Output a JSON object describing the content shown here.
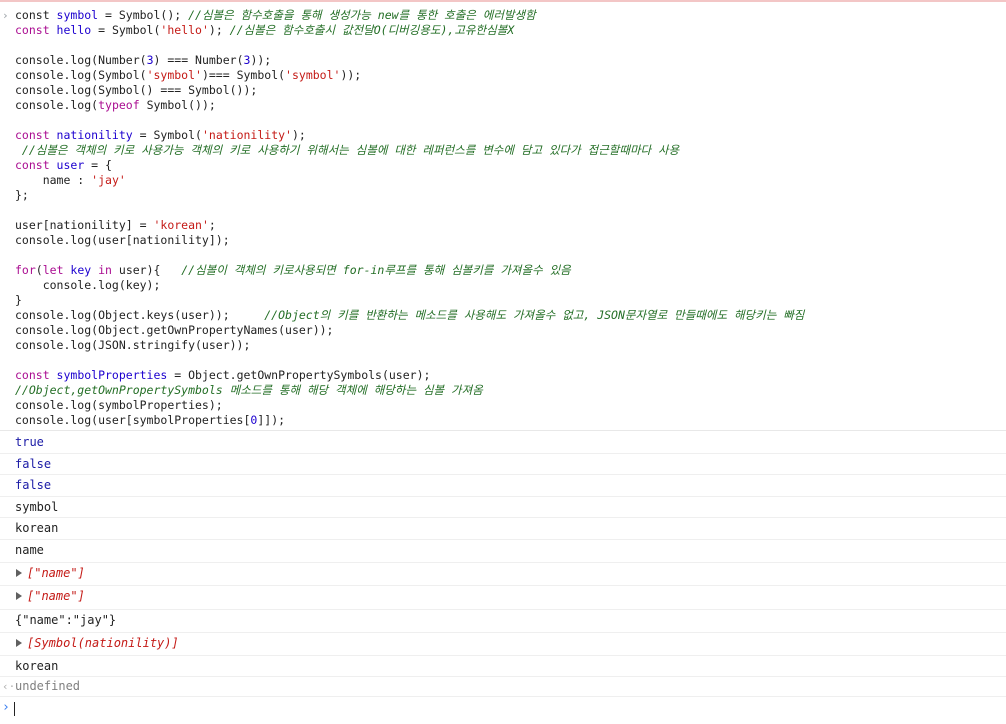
{
  "console": {
    "code_lines": [
      [
        {
          "t": "pl",
          "v": "const "
        },
        {
          "t": "vn",
          "v": "symbol"
        },
        {
          "t": "pl",
          "v": " = Symbol(); "
        },
        {
          "t": "cm",
          "v": "//심볼은 함수호출을 통해 생성가능 new를 통한 호출은 에러발생함"
        }
      ],
      [
        {
          "t": "kw",
          "v": "const "
        },
        {
          "t": "vn",
          "v": "hello"
        },
        {
          "t": "pl",
          "v": " = Symbol("
        },
        {
          "t": "str",
          "v": "'hello'"
        },
        {
          "t": "pl",
          "v": "); "
        },
        {
          "t": "cm",
          "v": "//심볼은 함수호출시 값전달O(디버깅용도),고유한심볼X"
        }
      ],
      [],
      [
        {
          "t": "pl",
          "v": "console.log(Number("
        },
        {
          "t": "num",
          "v": "3"
        },
        {
          "t": "pl",
          "v": ") === Number("
        },
        {
          "t": "num",
          "v": "3"
        },
        {
          "t": "pl",
          "v": "));"
        }
      ],
      [
        {
          "t": "pl",
          "v": "console.log(Symbol("
        },
        {
          "t": "str",
          "v": "'symbol'"
        },
        {
          "t": "pl",
          "v": ")=== Symbol("
        },
        {
          "t": "str",
          "v": "'symbol'"
        },
        {
          "t": "pl",
          "v": "));"
        }
      ],
      [
        {
          "t": "pl",
          "v": "console.log(Symbol() === Symbol());"
        }
      ],
      [
        {
          "t": "pl",
          "v": "console.log("
        },
        {
          "t": "kw",
          "v": "typeof"
        },
        {
          "t": "pl",
          "v": " Symbol());"
        }
      ],
      [],
      [
        {
          "t": "kw",
          "v": "const "
        },
        {
          "t": "vn",
          "v": "nationility"
        },
        {
          "t": "pl",
          "v": " = Symbol("
        },
        {
          "t": "str",
          "v": "'nationility'"
        },
        {
          "t": "pl",
          "v": ");"
        }
      ],
      [
        {
          "t": "cm",
          "v": " //심볼은 객체의 키로 사용가능 객체의 키로 사용하기 위해서는 심볼에 대한 레퍼런스를 변수에 담고 있다가 접근할때마다 사용"
        }
      ],
      [
        {
          "t": "kw",
          "v": "const "
        },
        {
          "t": "vn",
          "v": "user"
        },
        {
          "t": "pl",
          "v": " = {"
        }
      ],
      [
        {
          "t": "pl",
          "v": "    name : "
        },
        {
          "t": "str",
          "v": "'jay'"
        }
      ],
      [
        {
          "t": "pl",
          "v": "};"
        }
      ],
      [],
      [
        {
          "t": "pl",
          "v": "user[nationility] = "
        },
        {
          "t": "str",
          "v": "'korean'"
        },
        {
          "t": "pl",
          "v": ";"
        }
      ],
      [
        {
          "t": "pl",
          "v": "console.log(user[nationility]);"
        }
      ],
      [],
      [
        {
          "t": "kw",
          "v": "for"
        },
        {
          "t": "pl",
          "v": "("
        },
        {
          "t": "kw",
          "v": "let "
        },
        {
          "t": "vn",
          "v": "key"
        },
        {
          "t": "kw",
          "v": " in"
        },
        {
          "t": "pl",
          "v": " user){   "
        },
        {
          "t": "cm",
          "v": "//심볼이 객체의 키로사용되면 for-in루프를 통해 심볼키를 가져올수 있음"
        }
      ],
      [
        {
          "t": "pl",
          "v": "    console.log(key);"
        }
      ],
      [
        {
          "t": "pl",
          "v": "}"
        }
      ],
      [
        {
          "t": "pl",
          "v": "console.log(Object.keys(user));     "
        },
        {
          "t": "cm",
          "v": "//Object의 키를 반환하는 메소드를 사용해도 가져올수 없고, JSON문자열로 만들때에도 해당키는 빠짐"
        }
      ],
      [
        {
          "t": "pl",
          "v": "console.log(Object.getOwnPropertyNames(user));"
        }
      ],
      [
        {
          "t": "pl",
          "v": "console.log(JSON.stringify(user));"
        }
      ],
      [],
      [
        {
          "t": "kw",
          "v": "const "
        },
        {
          "t": "vn",
          "v": "symbolProperties"
        },
        {
          "t": "pl",
          "v": " = Object.getOwnPropertySymbols(user);"
        }
      ],
      [
        {
          "t": "cm",
          "v": "//Object,getOwnPropertySymbols 메소드를 통해 해당 객체에 해당하는 심볼 가져옴"
        }
      ],
      [
        {
          "t": "pl",
          "v": "console.log(symbolProperties);"
        }
      ],
      [
        {
          "t": "pl",
          "v": "console.log(user[symbolProperties["
        },
        {
          "t": "num",
          "v": "0"
        },
        {
          "t": "pl",
          "v": "]]);"
        }
      ]
    ],
    "outputs": [
      {
        "text": "true",
        "style": "bool",
        "expandable": false
      },
      {
        "text": "false",
        "style": "bool",
        "expandable": false
      },
      {
        "text": "false",
        "style": "bool",
        "expandable": false
      },
      {
        "text": "symbol",
        "style": "pl",
        "expandable": false
      },
      {
        "text": "korean",
        "style": "pl",
        "expandable": false
      },
      {
        "text": "name",
        "style": "pl",
        "expandable": false
      },
      {
        "text": "[\"name\"]",
        "style": "arr",
        "expandable": true
      },
      {
        "text": "[\"name\"]",
        "style": "arr",
        "expandable": true
      },
      {
        "text": "{\"name\":\"jay\"}",
        "style": "pl",
        "expandable": false
      },
      {
        "text": "[Symbol(nationility)]",
        "style": "sym",
        "expandable": true
      },
      {
        "text": "korean",
        "style": "pl",
        "expandable": false
      }
    ],
    "result_value": "undefined",
    "input_value": "",
    "icons": {
      "code_prompt": "chevron-right-icon",
      "result_prompt": "result-arrow-icon",
      "input_prompt": "input-chevron-icon",
      "expand": "expand-triangle-icon"
    }
  }
}
